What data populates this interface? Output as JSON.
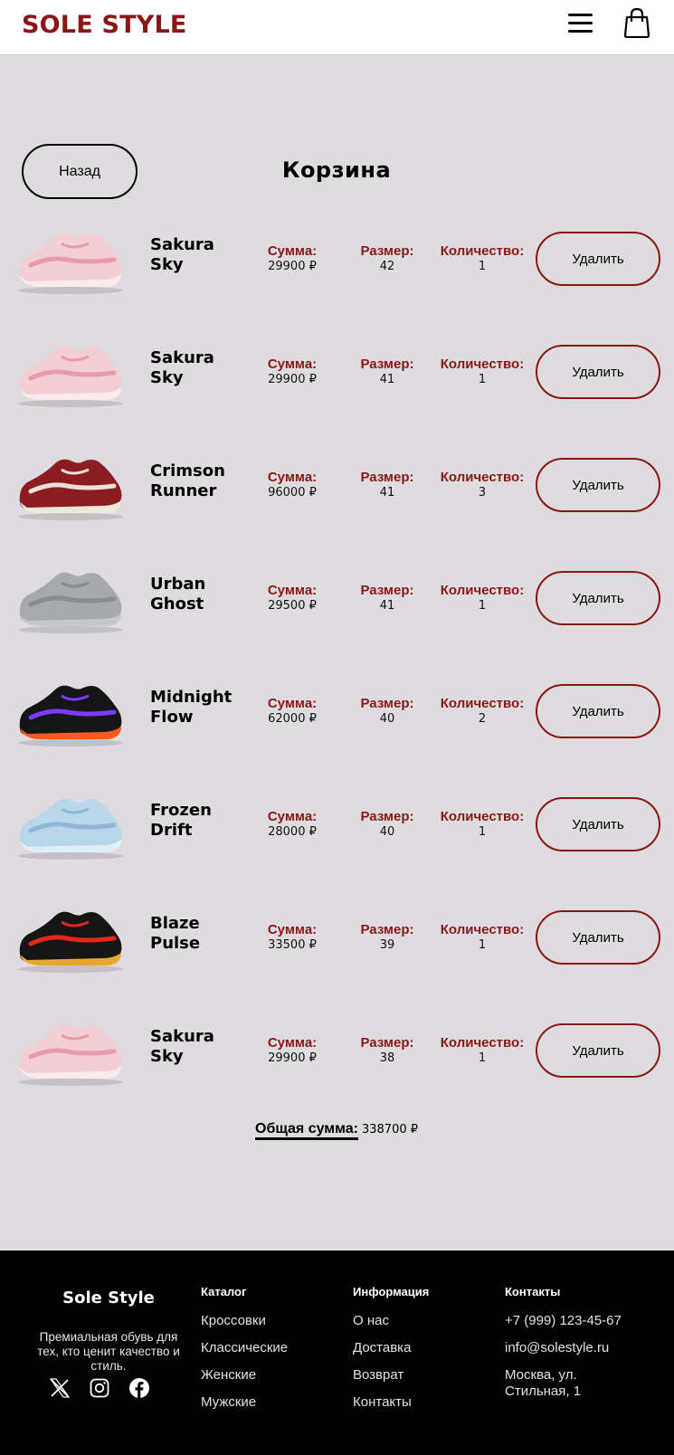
{
  "header": {
    "logo": "SOLE STYLE"
  },
  "cart": {
    "back_label": "Назад",
    "title": "Корзина",
    "sum_label": "Сумма:",
    "size_label": "Размер:",
    "qty_label": "Количество:",
    "delete_label": "Удалить",
    "items": [
      {
        "name": "Sakura Sky",
        "price": "29900 ₽",
        "size": "42",
        "qty": "1",
        "colors": {
          "body": "#f3cfd3",
          "accent": "#e79aa8",
          "sole": "#fbeaec"
        }
      },
      {
        "name": "Sakura Sky",
        "price": "29900 ₽",
        "size": "41",
        "qty": "1",
        "colors": {
          "body": "#f3cfd3",
          "accent": "#e79aa8",
          "sole": "#fbeaec"
        }
      },
      {
        "name": "Crimson Runner",
        "price": "96000 ₽",
        "size": "41",
        "qty": "3",
        "colors": {
          "body": "#8c1c22",
          "accent": "#e8e3da",
          "sole": "#eee8dd"
        }
      },
      {
        "name": "Urban Ghost",
        "price": "29500 ₽",
        "size": "41",
        "qty": "1",
        "colors": {
          "body": "#a7a9ad",
          "accent": "#8a8c90",
          "sole": "#c6c8cb"
        }
      },
      {
        "name": "Midnight Flow",
        "price": "62000 ₽",
        "size": "40",
        "qty": "2",
        "colors": {
          "body": "#151515",
          "accent": "#7b3cff",
          "sole": "#ff5a1f"
        }
      },
      {
        "name": "Frozen Drift",
        "price": "28000 ₽",
        "size": "40",
        "qty": "1",
        "colors": {
          "body": "#b9d7ea",
          "accent": "#8fb8d6",
          "sole": "#e3eff7"
        }
      },
      {
        "name": "Blaze Pulse",
        "price": "33500 ₽",
        "size": "39",
        "qty": "1",
        "colors": {
          "body": "#151515",
          "accent": "#e5261c",
          "sole": "#e8a82d"
        }
      },
      {
        "name": "Sakura Sky",
        "price": "29900 ₽",
        "size": "38",
        "qty": "1",
        "colors": {
          "body": "#f3cfd3",
          "accent": "#e79aa8",
          "sole": "#fbeaec"
        }
      }
    ],
    "total_label": "Общая сумма:",
    "total_value": "338700 ₽"
  },
  "footer": {
    "brand": "Sole Style",
    "description": "Премиальная обувь для тех, кто ценит качество и стиль.",
    "social": [
      "x-icon",
      "instagram-icon",
      "facebook-icon"
    ],
    "catalog": {
      "title": "Каталог",
      "links": [
        "Кроссовки",
        "Классические",
        "Женские",
        "Мужские"
      ]
    },
    "info": {
      "title": "Информация",
      "links": [
        "О нас",
        "Доставка",
        "Возврат",
        "Контакты"
      ]
    },
    "contacts": {
      "title": "Контакты",
      "phone": "+7 (999) 123-45-67",
      "email": "info@solestyle.ru",
      "address": "Москва, ул. Стильная, 1"
    }
  }
}
